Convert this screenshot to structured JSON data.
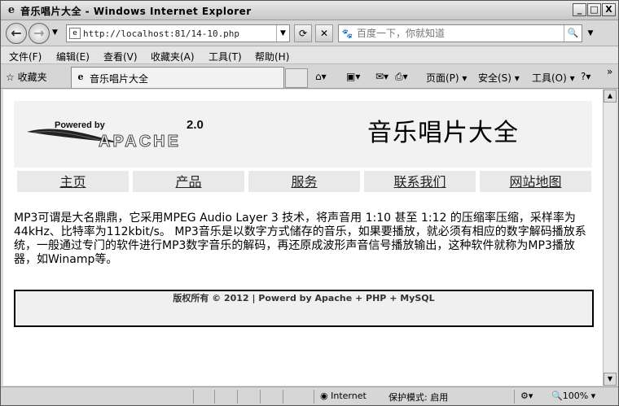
{
  "window": {
    "title": "音乐唱片大全 - Windows Internet Explorer",
    "minimize": "_",
    "maximize": "□",
    "close": "X"
  },
  "address_bar": {
    "url": "http://localhost:81/14-10.php",
    "search_placeholder": "百度一下，你就知道"
  },
  "menu": [
    "文件(F)",
    "编辑(E)",
    "查看(V)",
    "收藏夹(A)",
    "工具(T)",
    "帮助(H)"
  ],
  "favorites_label": "收藏夹",
  "tab": {
    "label": "音乐唱片大全"
  },
  "toolbar": {
    "page": "页面(P)",
    "safety": "安全(S)",
    "tools": "工具(O)"
  },
  "page": {
    "logo_text_powered": "Powered by",
    "logo_text_apache": "APACHE",
    "logo_text_version": "2.0",
    "site_title": "音乐唱片大全",
    "nav": [
      "主页",
      "产品",
      "服务",
      "联系我们",
      "网站地图"
    ],
    "paragraph": "MP3可谓是大名鼎鼎，它采用MPEG Audio Layer 3 技术，将声音用 1:10 甚至 1:12 的压缩率压缩，采样率为44kHz、比特率为112kbit/s。 MP3音乐是以数字方式储存的音乐，如果要播放，就必须有相应的数字解码播放系统，一般通过专门的软件进行MP3数字音乐的解码，再还原成波形声音信号播放输出，这种软件就称为MP3播放器，如Winamp等。",
    "footer": "版权所有 © 2012 | Powerd by Apache + PHP + MySQL"
  },
  "status_bar": {
    "zone": "Internet",
    "protected_mode": "保护模式: 启用",
    "zoom": "100%"
  }
}
